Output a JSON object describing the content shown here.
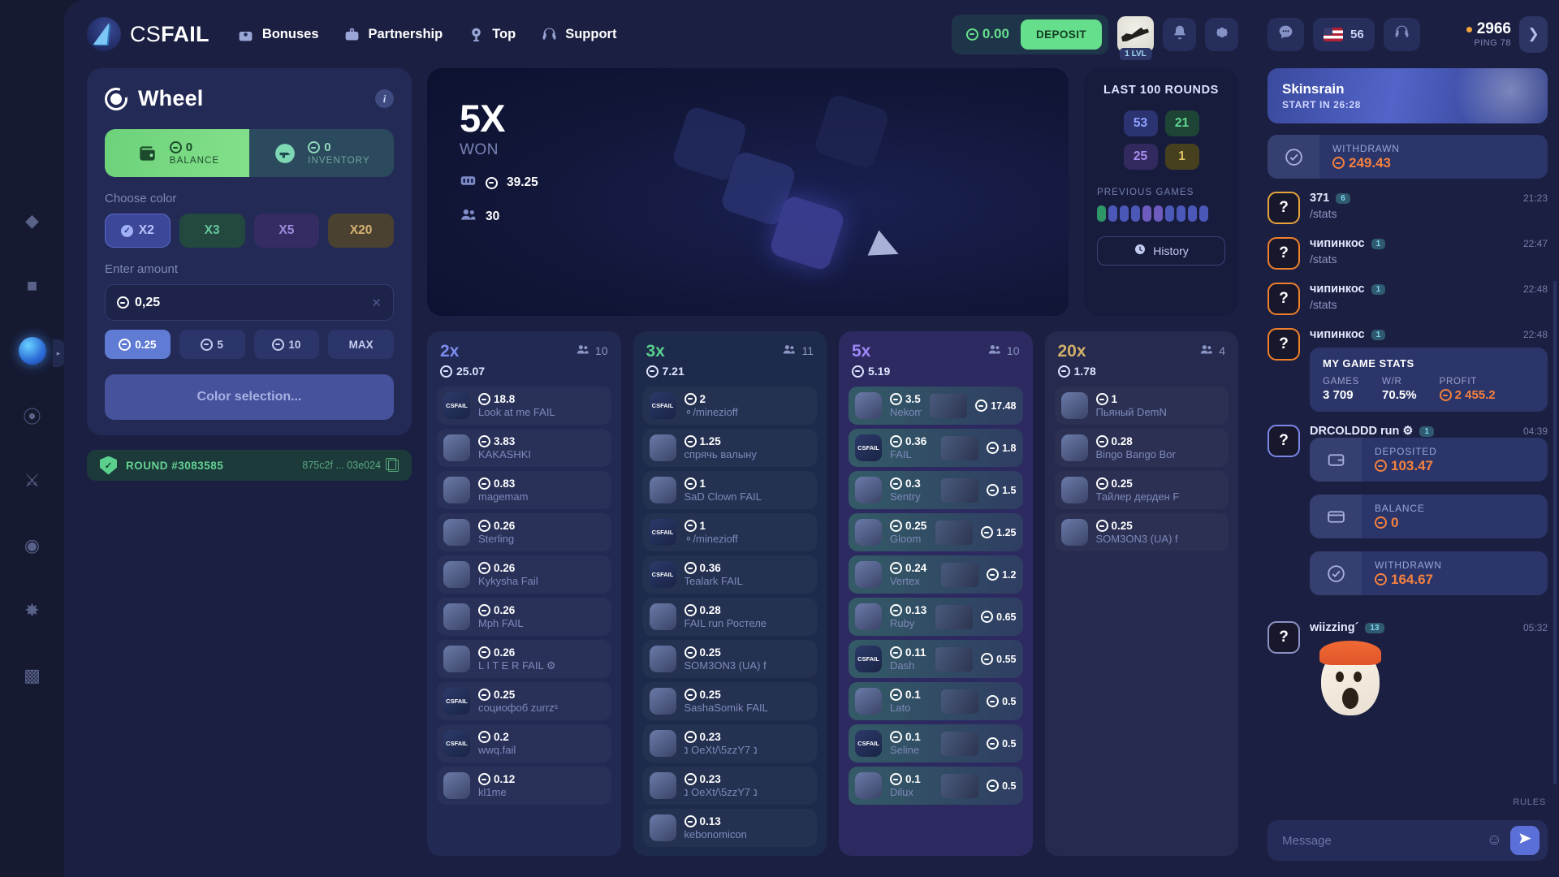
{
  "header": {
    "brand": {
      "prefix": "CS",
      "suffix": "FAIL"
    },
    "nav": [
      {
        "label": "Bonuses",
        "icon": "gift-icon"
      },
      {
        "label": "Partnership",
        "icon": "briefcase-icon"
      },
      {
        "label": "Top",
        "icon": "trophy-icon"
      },
      {
        "label": "Support",
        "icon": "headset-icon"
      }
    ],
    "balance": "0.00",
    "deposit_label": "DEPOSIT",
    "level_badge": "1 LVL",
    "bell_icon": "bell-icon",
    "settings_icon": "gear-icon"
  },
  "wheel": {
    "title": "Wheel",
    "info_icon": "info-icon",
    "modes": [
      {
        "key": "balance",
        "value": "0",
        "label": "BALANCE",
        "icon": "wallet-icon"
      },
      {
        "key": "inventory",
        "value": "0",
        "label": "INVENTORY",
        "icon": "skin-icon"
      }
    ],
    "choose_color_label": "Choose color",
    "colors": [
      {
        "label": "X2",
        "selected": true
      },
      {
        "label": "X3",
        "selected": false
      },
      {
        "label": "X5",
        "selected": false
      },
      {
        "label": "X20",
        "selected": false
      }
    ],
    "amount_label": "Enter amount",
    "amount_value": "0,25",
    "quick_amounts": [
      {
        "label": "0.25",
        "selected": true
      },
      {
        "label": "5",
        "selected": false
      },
      {
        "label": "10",
        "selected": false
      },
      {
        "label": "MAX",
        "selected": false
      }
    ],
    "select_button": "Color selection...",
    "round_label": "ROUND #3083585",
    "round_hash": "875c2f ... 03e024",
    "copy_icon": "copy-icon"
  },
  "stage": {
    "multiplier": "5X",
    "won_label": "WON",
    "bank": "39.25",
    "players": "30",
    "bank_icon": "bank-icon",
    "players_icon": "players-icon"
  },
  "last100": {
    "title": "LAST 100 ROUNDS",
    "cells": [
      {
        "value": "53",
        "kind": "x2"
      },
      {
        "value": "21",
        "kind": "x3"
      },
      {
        "value": "25",
        "kind": "x5"
      },
      {
        "value": "1",
        "kind": "x20"
      }
    ],
    "previous_games_label": "PREVIOUS GAMES",
    "previous_games": [
      "x3",
      "x2",
      "x2",
      "x2",
      "x5",
      "x5",
      "x2",
      "x2",
      "x2",
      "x2"
    ],
    "history_label": "History",
    "history_icon": "clock-icon"
  },
  "bet_columns": [
    {
      "mult": "2x",
      "total": "25.07",
      "players": "10",
      "kind": "x2",
      "bets": [
        {
          "amount": "18.8",
          "name": "Look at me FAIL",
          "avatar": "CSFAIL"
        },
        {
          "amount": "3.83",
          "name": "KAKASHKI",
          "avatar": "pancake"
        },
        {
          "amount": "0.83",
          "name": "magemam",
          "avatar": "photo"
        },
        {
          "amount": "0.26",
          "name": "Sterling",
          "avatar": "photo"
        },
        {
          "amount": "0.26",
          "name": "Kykysha Fail",
          "avatar": "photo"
        },
        {
          "amount": "0.26",
          "name": "Mph FAIL",
          "avatar": "photo"
        },
        {
          "amount": "0.26",
          "name": "L I T E R FAIL ⚙",
          "avatar": "photo"
        },
        {
          "amount": "0.25",
          "name": "социофоб zurrzˢ",
          "avatar": "CSFAIL"
        },
        {
          "amount": "0.2",
          "name": "wwq.fail",
          "avatar": "CSFAIL"
        },
        {
          "amount": "0.12",
          "name": "kl1me",
          "avatar": "photo"
        }
      ]
    },
    {
      "mult": "3x",
      "total": "7.21",
      "players": "11",
      "kind": "x3",
      "bets": [
        {
          "amount": "2",
          "name": "⚬/minezioff",
          "avatar": "CSFAIL"
        },
        {
          "amount": "1.25",
          "name": "спрячь валыну",
          "avatar": "photo"
        },
        {
          "amount": "1",
          "name": "SaD Clown FAIL",
          "avatar": "photo"
        },
        {
          "amount": "1",
          "name": "⚬/minezioff",
          "avatar": "CSFAIL"
        },
        {
          "amount": "0.36",
          "name": "Tealark FAIL",
          "avatar": "CSFAIL"
        },
        {
          "amount": "0.28",
          "name": "FAIL run Ростеле",
          "avatar": "photo"
        },
        {
          "amount": "0.25",
          "name": "SOM3ON3 (UA) f",
          "avatar": "photo"
        },
        {
          "amount": "0.25",
          "name": "SashaSomik FAIL",
          "avatar": "photo"
        },
        {
          "amount": "0.23",
          "name": "נ OeXt/\\5zzY7 נ",
          "avatar": "photo"
        },
        {
          "amount": "0.23",
          "name": "נ OeXt/\\5zzY7 נ",
          "avatar": "photo"
        },
        {
          "amount": "0.13",
          "name": "kebonomicon",
          "avatar": "photo"
        }
      ]
    },
    {
      "mult": "5x",
      "total": "5.19",
      "players": "10",
      "kind": "x5",
      "winner": true,
      "bets": [
        {
          "amount": "3.5",
          "name": "Nekomi",
          "avatar": "photo",
          "prize": "17.48"
        },
        {
          "amount": "0.36",
          "name": "FAIL",
          "avatar": "CSFAIL",
          "prize": "1.8"
        },
        {
          "amount": "0.3",
          "name": "Sentry",
          "avatar": "photo",
          "prize": "1.5"
        },
        {
          "amount": "0.25",
          "name": "Gloom",
          "avatar": "photo",
          "prize": "1.25"
        },
        {
          "amount": "0.24",
          "name": "Vertex",
          "avatar": "photo",
          "prize": "1.2"
        },
        {
          "amount": "0.13",
          "name": "Ruby",
          "avatar": "photo",
          "prize": "0.65"
        },
        {
          "amount": "0.11",
          "name": "Dash",
          "avatar": "CSFAIL",
          "prize": "0.55"
        },
        {
          "amount": "0.1",
          "name": "Lato",
          "avatar": "photo",
          "prize": "0.5"
        },
        {
          "amount": "0.1",
          "name": "Seline",
          "avatar": "CSFAIL",
          "prize": "0.5"
        },
        {
          "amount": "0.1",
          "name": "Dilux",
          "avatar": "photo",
          "prize": "0.5"
        }
      ]
    },
    {
      "mult": "20x",
      "total": "1.78",
      "players": "4",
      "kind": "x20",
      "bets": [
        {
          "amount": "1",
          "name": "Пьяный DemN",
          "avatar": "photo"
        },
        {
          "amount": "0.28",
          "name": "Bingo Bango Bor",
          "avatar": "photo"
        },
        {
          "amount": "0.25",
          "name": "Тайлер дерден F",
          "avatar": "photo"
        },
        {
          "amount": "0.25",
          "name": "SOM3ON3 (UA) f",
          "avatar": "photo"
        }
      ]
    }
  ],
  "chat": {
    "chat_icon": "chat-bubble-icon",
    "headset_icon": "headset-icon",
    "lang_count": "56",
    "online": "2966",
    "ping": "PING 78",
    "collapse_icon": "chevron-right-icon",
    "promo": {
      "title": "Skinsrain",
      "subtitle": "START IN 26:28"
    },
    "events_top": [
      {
        "label": "WITHDRAWN",
        "value": "249.43",
        "icon": "check-circle-icon"
      }
    ],
    "messages": [
      {
        "user": "371",
        "level": "6",
        "time": "21:23",
        "text": "/stats",
        "avatar_border": "#e8a33c",
        "avatar_glyph": "?"
      },
      {
        "user": "чипинкос",
        "level": "1",
        "time": "22:47",
        "text": "/stats",
        "avatar_border": "#f07f2c",
        "avatar_glyph": "?"
      },
      {
        "user": "чипинкос",
        "level": "1",
        "time": "22:48",
        "text": "/stats",
        "avatar_border": "#f07f2c",
        "avatar_glyph": "?"
      },
      {
        "user": "чипинкос",
        "level": "1",
        "time": "22:48",
        "text": "",
        "avatar_border": "#f07f2c",
        "avatar_glyph": "?",
        "stats": {
          "title": "MY GAME STATS",
          "items": [
            {
              "label": "GAMES",
              "value": "3 709",
              "orange": false
            },
            {
              "label": "W/R",
              "value": "70.5%",
              "orange": false
            },
            {
              "label": "PROFIT",
              "value": "2 455.2",
              "orange": true
            }
          ]
        }
      },
      {
        "user": "DRCOLDDD run ⚙",
        "level": "1",
        "time": "04:39",
        "text": "",
        "avatar_border": "#7b86e8",
        "avatar_glyph": "?",
        "events": [
          {
            "label": "DEPOSITED",
            "value": "103.47",
            "icon": "wallet-icon"
          },
          {
            "label": "BALANCE",
            "value": "0",
            "icon": "card-icon"
          },
          {
            "label": "WITHDRAWN",
            "value": "164.67",
            "icon": "check-circle-icon"
          }
        ]
      },
      {
        "user": "wiizzing´",
        "level": "13",
        "time": "05:32",
        "text": "",
        "avatar_border": "#8c93c4",
        "avatar_glyph": "?",
        "sticker": "screaming-ghost-sticker"
      }
    ],
    "rules_label": "RULES",
    "input_placeholder": "Message",
    "emoji_icon": "emoji-icon",
    "send_icon": "send-icon"
  },
  "rail": {
    "items": [
      {
        "name": "case-battle",
        "active": false
      },
      {
        "name": "cases",
        "active": false
      },
      {
        "name": "wheel",
        "active": true
      },
      {
        "name": "crash",
        "active": false
      },
      {
        "name": "upgrade",
        "active": false
      },
      {
        "name": "slots",
        "active": false
      },
      {
        "name": "mines",
        "active": false
      },
      {
        "name": "contract",
        "active": false
      }
    ]
  },
  "colors": {
    "accent_green": "#66df8c",
    "accent_orange": "#f4813f",
    "x2": "#7b8cf0",
    "x3": "#57cf8d",
    "x5": "#9b86f5",
    "x20": "#d0b06a"
  }
}
